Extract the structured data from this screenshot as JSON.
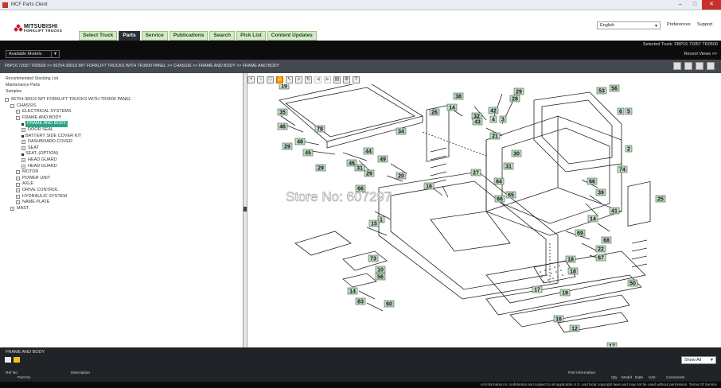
{
  "window": {
    "title": "MCF Parts Client"
  },
  "logo": {
    "line1": "MITSUBISHI",
    "line2": "FORKLIFT TRUCKS"
  },
  "tabs": [
    {
      "label": "Select Truck"
    },
    {
      "label": "Parts",
      "active": true
    },
    {
      "label": "Service"
    },
    {
      "label": "Publications"
    },
    {
      "label": "Search"
    },
    {
      "label": "Pick List"
    },
    {
      "label": "Content Updates"
    }
  ],
  "header": {
    "language": "English",
    "preferences": "Preferences",
    "support": "Support"
  },
  "selected_truck": "Selected Truck: FBP16 72057 TR0500",
  "models_select": "Available Models",
  "recent_views": "Recent Views >>",
  "breadcrumb": "FBP16 72057 TR0500 >> 56754-30010 M/T FORKLIFT TRUCKS WITH TR3500 PANEL >> CHASSIS >> FRAME AND BODY >> FRAME AND BODY",
  "left_links": [
    "Recommended Stocking List",
    "Maintenance Parts",
    "Samples"
  ],
  "tree": [
    {
      "label": "56754-30010 M/T FORKLIFT TRUCKS WITH TR3500 PANEL",
      "indent": 0,
      "toggle": "-"
    },
    {
      "label": "CHASSIS",
      "indent": 1,
      "toggle": "-"
    },
    {
      "label": "ELECTRICAL SYSTEMS",
      "indent": 2,
      "toggle": "+"
    },
    {
      "label": "FRAME AND BODY",
      "indent": 2,
      "toggle": "-"
    },
    {
      "label": "FRAME AND BODY",
      "indent": 3,
      "bullet": true,
      "selected": true
    },
    {
      "label": "DOOR SEAL",
      "indent": 3,
      "toggle": "+"
    },
    {
      "label": "BATTERY SIDE COVER KIT",
      "indent": 3,
      "bullet": true
    },
    {
      "label": "DASHBOARD COVER",
      "indent": 3,
      "toggle": "+"
    },
    {
      "label": "SEAT",
      "indent": 3,
      "toggle": "+"
    },
    {
      "label": "SEAT, (OPTION)",
      "indent": 3,
      "bullet": true
    },
    {
      "label": "HEAD GUARD",
      "indent": 3,
      "toggle": "+"
    },
    {
      "label": "HEAD GUARD",
      "indent": 3,
      "toggle": "+"
    },
    {
      "label": "MOTOR",
      "indent": 2,
      "toggle": "+"
    },
    {
      "label": "POWER UNIT",
      "indent": 2,
      "toggle": "+"
    },
    {
      "label": "AXLE",
      "indent": 2,
      "toggle": "+"
    },
    {
      "label": "DRIVE CONTROL",
      "indent": 2,
      "toggle": "+"
    },
    {
      "label": "HYDRAULIC SYSTEM",
      "indent": 2,
      "toggle": "+"
    },
    {
      "label": "NAME PLATE",
      "indent": 2,
      "toggle": "+"
    },
    {
      "label": "MAST",
      "indent": 1,
      "toggle": "+"
    }
  ],
  "diagram": {
    "watermark": "Store No: 607297",
    "callouts": [
      "19",
      "35",
      "46",
      "29",
      "48",
      "78",
      "29",
      "45",
      "34",
      "38",
      "14",
      "42",
      "32",
      "28",
      "29",
      "43",
      "4",
      "3",
      "21",
      "31",
      "26",
      "53",
      "56",
      "6",
      "5",
      "2",
      "30",
      "44",
      "49",
      "46",
      "31",
      "29",
      "20",
      "27",
      "64",
      "16",
      "74",
      "66",
      "66",
      "65",
      "39",
      "14",
      "41",
      "25",
      "66",
      "1",
      "15",
      "69",
      "68",
      "22",
      "67",
      "18",
      "73",
      "56",
      "10",
      "18",
      "17",
      "19",
      "50",
      "14",
      "83",
      "60",
      "16",
      "12",
      "17"
    ]
  },
  "colors": {
    "tab_bg": "#d4e9c8",
    "tab_active": "#2d3035",
    "highlight": "#2aa68a",
    "diagram_callout_bg": "#bfe0c2",
    "logo_red": "#c8102e"
  },
  "bottom": {
    "title": "FRAME AND BODY",
    "show_all": "Show All",
    "columns": [
      "Ref No",
      "Part No",
      "Description",
      "Part Information",
      "Qty",
      "Model",
      "Date",
      "Unit",
      "Comments"
    ],
    "footer": "All information is confidential and subject to all applicable U.S. and local copyright laws and may not be used without permission. Terms Of Service"
  }
}
